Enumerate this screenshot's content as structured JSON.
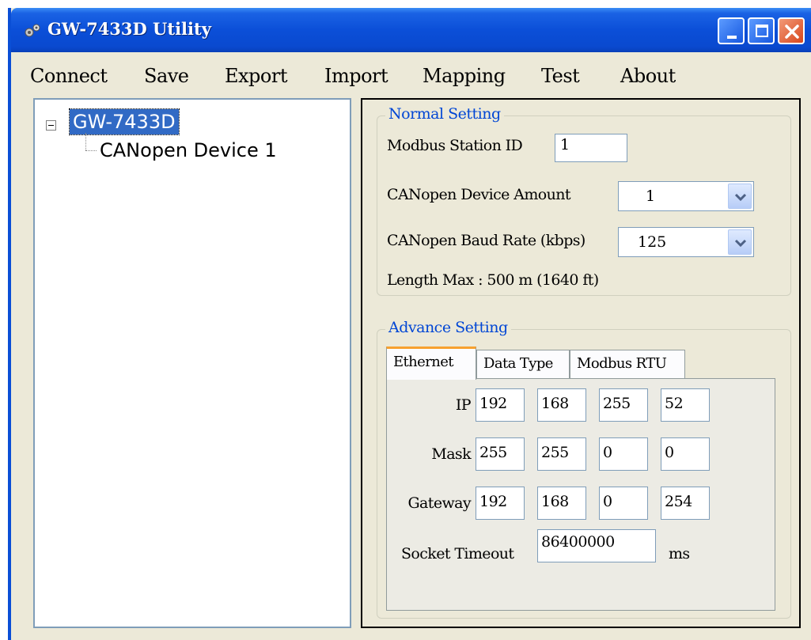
{
  "window": {
    "title": "GW-7433D Utility"
  },
  "menu": [
    "Connect",
    "Save",
    "Export",
    "Import",
    "Mapping",
    "Test",
    "About"
  ],
  "tree": {
    "root": "GW-7433D",
    "child": "CANopen Device 1"
  },
  "normal": {
    "title": "Normal Setting",
    "station_label": "Modbus Station ID",
    "station_value": "1",
    "amount_label": "CANopen Device Amount",
    "amount_value": "1",
    "baud_label": "CANopen Baud Rate (kbps)",
    "baud_value": "125",
    "length_text": "Length Max : 500 m (1640 ft)"
  },
  "advance": {
    "title": "Advance Setting",
    "tabs": [
      "Ethernet",
      "Data Type",
      "Modbus RTU"
    ],
    "ip_label": "IP",
    "ip": [
      "192",
      "168",
      "255",
      "52"
    ],
    "mask_label": "Mask",
    "mask": [
      "255",
      "255",
      "0",
      "0"
    ],
    "gateway_label": "Gateway",
    "gateway": [
      "192",
      "168",
      "0",
      "254"
    ],
    "timeout_label": "Socket Timeout",
    "timeout_value": "86400000",
    "timeout_unit": "ms"
  },
  "colors": {
    "titlebar": "#0b4fd8",
    "window_bg": "#ece9d8",
    "selection": "#316ac5",
    "group_title": "#0046d5",
    "tab_accent": "#f7a12e"
  },
  "icons": [
    "gears-icon",
    "minimize-icon",
    "maximize-icon",
    "close-icon",
    "tree-collapse-icon",
    "dropdown-arrow-icon"
  ]
}
